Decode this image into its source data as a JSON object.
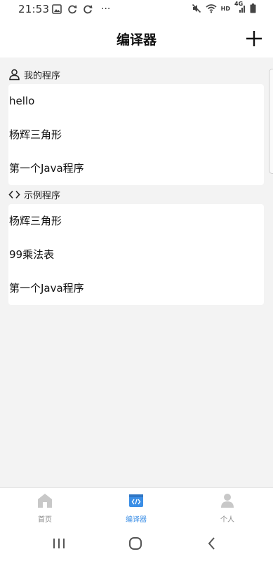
{
  "status_bar": {
    "time": "21:53",
    "more": "···",
    "network_label": "HD",
    "signal_label": "4G"
  },
  "header": {
    "title": "编译器"
  },
  "my_programs": {
    "title": "我的程序",
    "items": [
      "hello",
      "杨辉三角形",
      "第一个Java程序"
    ]
  },
  "example_programs": {
    "title": "示例程序",
    "items": [
      "杨辉三角形",
      "99乘法表",
      "第一个Java程序"
    ]
  },
  "tab_bar": {
    "tabs": [
      {
        "label": "首页",
        "icon": "home-icon"
      },
      {
        "label": "编译器",
        "icon": "compiler-icon",
        "active": true
      },
      {
        "label": "个人",
        "icon": "person-icon"
      }
    ],
    "active_color": "#3a8ee6",
    "inactive_color": "#c8c8c8"
  },
  "nav_bar": {
    "buttons": [
      "recent-apps-icon",
      "home-circle-icon",
      "back-icon"
    ]
  }
}
